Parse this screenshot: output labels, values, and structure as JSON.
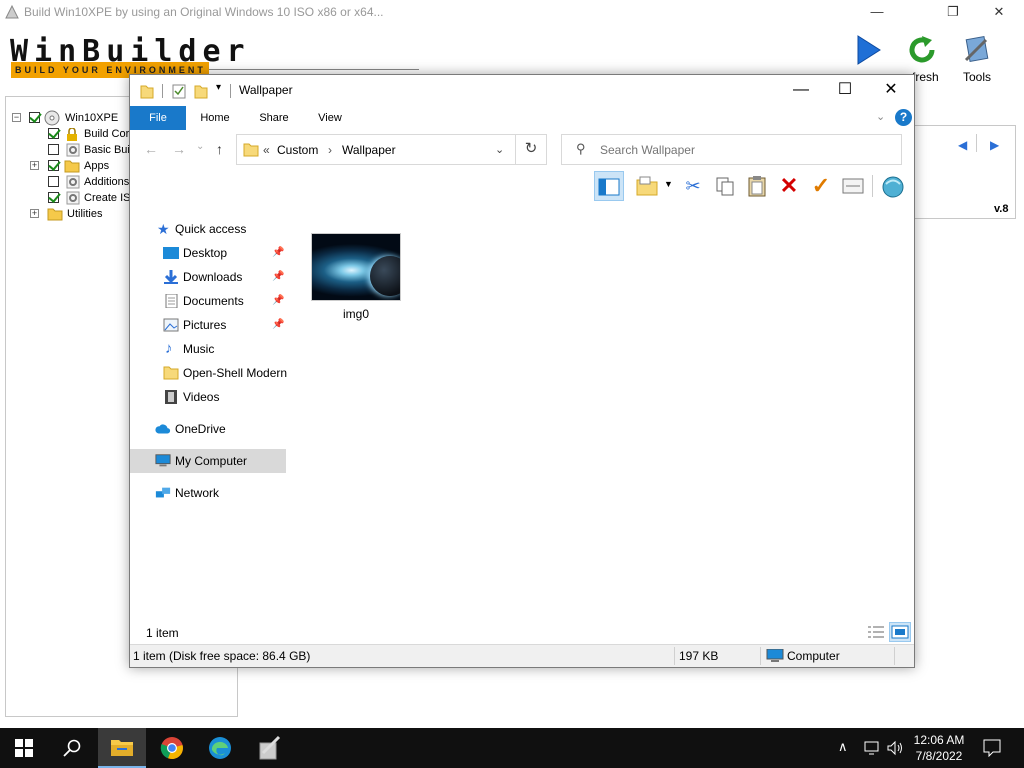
{
  "winbuilder": {
    "title": "Build Win10XPE by using an Original Windows 10 ISO x86 or x64...",
    "logo": "WinBuilder",
    "tagline": "BUILD YOUR ENVIRONMENT",
    "tools": [
      {
        "label": "",
        "icon": "play-icon"
      },
      {
        "label": "efresh",
        "icon": "refresh-icon"
      },
      {
        "label": "Tools",
        "icon": "tools-icon"
      }
    ],
    "tree": [
      {
        "label": "Win10XPE",
        "checked": true
      },
      {
        "label": "Build Core",
        "checked": true
      },
      {
        "label": "Basic Build",
        "checked": false
      },
      {
        "label": "Apps",
        "checked": true
      },
      {
        "label": "Additions",
        "checked": false
      },
      {
        "label": "Create ISO",
        "checked": true
      },
      {
        "label": "Utilities",
        "checked": false
      }
    ],
    "version": "v.8"
  },
  "explorer": {
    "title": "Wallpaper",
    "tabs": [
      "File",
      "Home",
      "Share",
      "View"
    ],
    "address": {
      "prefix": "«",
      "segments": [
        "Custom",
        "Wallpaper"
      ]
    },
    "search_placeholder": "Search Wallpaper",
    "nav": {
      "quick_access": "Quick access",
      "pinned": [
        "Desktop",
        "Downloads",
        "Documents",
        "Pictures"
      ],
      "other": [
        "Music",
        "Open-Shell Modern",
        "Videos"
      ],
      "onedrive": "OneDrive",
      "computer": "My Computer",
      "network": "Network"
    },
    "files": [
      {
        "name": "img0"
      }
    ],
    "item_count": "1 item",
    "status": {
      "summary": "1 item (Disk free space: 86.4 GB)",
      "size": "197 KB",
      "location": "Computer"
    }
  },
  "taskbar": {
    "time": "12:06 AM",
    "date": "7/8/2022"
  }
}
